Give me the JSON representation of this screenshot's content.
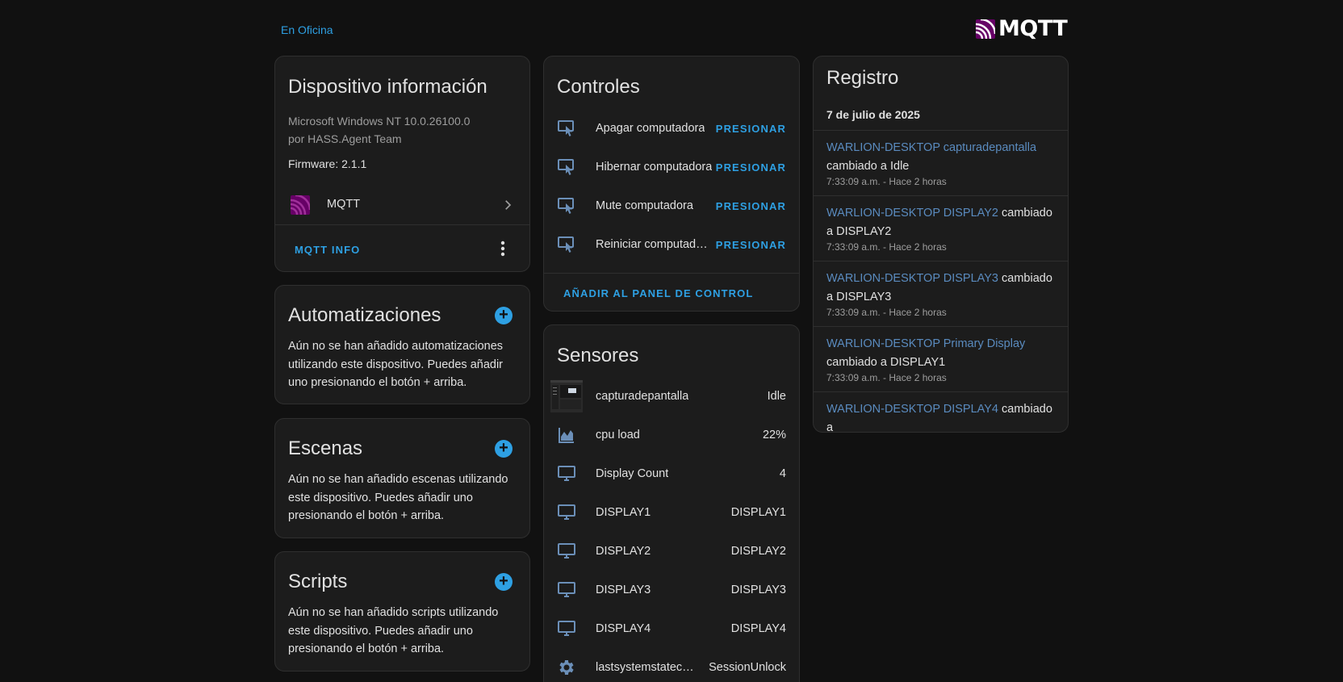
{
  "header": {
    "breadcrumb": "En Oficina",
    "brand": "MQTT"
  },
  "device_info": {
    "title": "Dispositivo información",
    "model": "Microsoft Windows NT 10.0.26100.0",
    "manufacturer": "por HASS.Agent Team",
    "firmware": "Firmware: 2.1.1",
    "integration": "MQTT",
    "action": "MQTT INFO"
  },
  "automations": {
    "title": "Automatizaciones",
    "text": "Aún no se han añadido automatizaciones utilizando este dispositivo. Puedes añadir uno presionando el botón + arriba."
  },
  "scenes": {
    "title": "Escenas",
    "text": "Aún no se han añadido escenas utilizando este dispositivo. Puedes añadir uno presionando el botón + arriba."
  },
  "scripts": {
    "title": "Scripts",
    "text": "Aún no se han añadido scripts utilizando este dispositivo. Puedes añadir uno presionando el botón + arriba."
  },
  "controls": {
    "title": "Controles",
    "items": [
      {
        "name": "Apagar computadora",
        "action": "PRESIONAR",
        "icon": "button-press-icon"
      },
      {
        "name": "Hibernar computadora",
        "action": "PRESIONAR",
        "icon": "button-press-icon"
      },
      {
        "name": "Mute computadora",
        "action": "PRESIONAR",
        "icon": "button-press-icon"
      },
      {
        "name": "Reiniciar computado…",
        "action": "PRESIONAR",
        "icon": "button-press-icon"
      }
    ],
    "add_action": "AÑADIR AL PANEL DE CONTROL"
  },
  "sensors": {
    "title": "Sensores",
    "items": [
      {
        "name": "capturadepantalla",
        "value": "Idle",
        "icon": "screenshot-thumbnail"
      },
      {
        "name": "cpu load",
        "value": "22%",
        "icon": "chart-area-icon"
      },
      {
        "name": "Display Count",
        "value": "4",
        "icon": "monitor-icon"
      },
      {
        "name": "DISPLAY1",
        "value": "DISPLAY1",
        "icon": "monitor-icon"
      },
      {
        "name": "DISPLAY2",
        "value": "DISPLAY2",
        "icon": "monitor-icon"
      },
      {
        "name": "DISPLAY3",
        "value": "DISPLAY3",
        "icon": "monitor-icon"
      },
      {
        "name": "DISPLAY4",
        "value": "DISPLAY4",
        "icon": "monitor-icon"
      },
      {
        "name": "lastsystemstatech…",
        "value": "SessionUnlock",
        "icon": "gear-icon"
      }
    ]
  },
  "logbook": {
    "title": "Registro",
    "date": "7 de julio de 2025",
    "entries": [
      {
        "entity": "WARLION-DESKTOP capturadepantalla",
        "change": "cambiado a Idle",
        "time": "7:33:09 a.m. - Hace 2 horas"
      },
      {
        "entity": "WARLION-DESKTOP DISPLAY2",
        "change": "cambiado a DISPLAY2",
        "time": "7:33:09 a.m. - Hace 2 horas"
      },
      {
        "entity": "WARLION-DESKTOP DISPLAY3",
        "change": "cambiado a DISPLAY3",
        "time": "7:33:09 a.m. - Hace 2 horas"
      },
      {
        "entity": "WARLION-DESKTOP Primary Display",
        "change": "cambiado a DISPLAY1",
        "time": "7:33:09 a.m. - Hace 2 horas"
      },
      {
        "entity": "WARLION-DESKTOP DISPLAY4",
        "change": "cambiado a",
        "time": ""
      }
    ]
  },
  "colors": {
    "accent": "#2ea0e3",
    "background": "#111111",
    "card": "#1c1c1c",
    "mqtt_logo": "#660066",
    "icon": "#6b8fb8",
    "log_link": "#5a8bbf"
  }
}
